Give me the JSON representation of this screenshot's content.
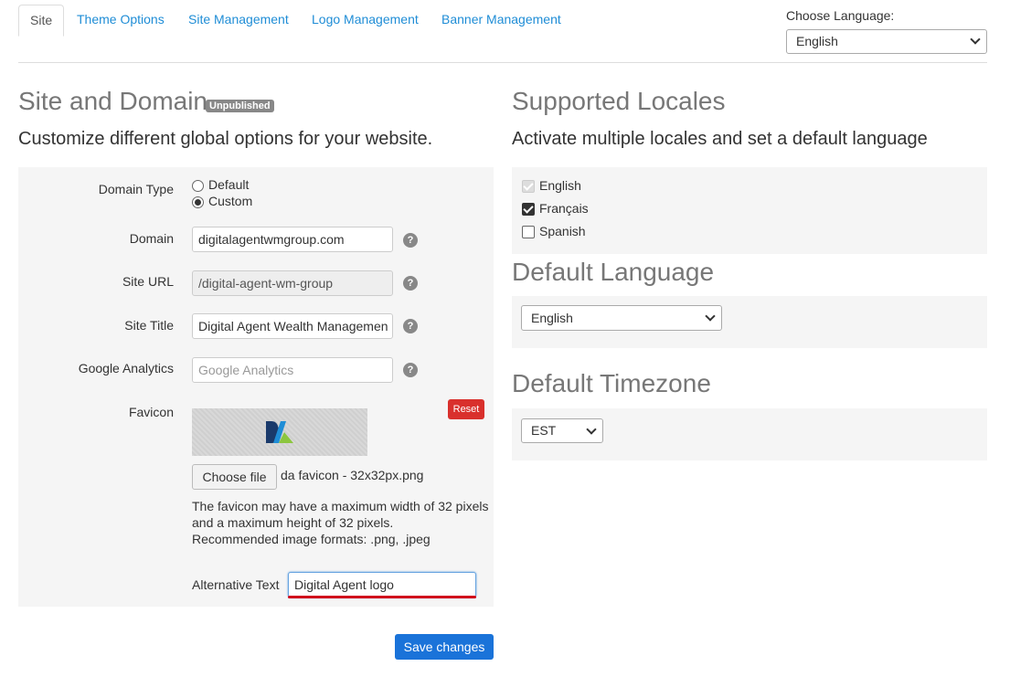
{
  "tabs": [
    "Site",
    "Theme Options",
    "Site Management",
    "Logo Management",
    "Banner Management"
  ],
  "language_chooser": {
    "label": "Choose Language:",
    "value": "English"
  },
  "site_domain": {
    "title": "Site and Domain",
    "badge": "Unpublished",
    "subtitle": "Customize different global options for your website.",
    "domain_type": {
      "label": "Domain Type",
      "options": [
        "Default",
        "Custom"
      ],
      "selected": "Custom"
    },
    "domain": {
      "label": "Domain",
      "value": "digitalagentwmgroup.com"
    },
    "site_url": {
      "label": "Site URL",
      "value": "/digital-agent-wm-group"
    },
    "site_title": {
      "label": "Site Title",
      "value": "Digital Agent Wealth Managemen"
    },
    "google_analytics": {
      "label": "Google Analytics",
      "placeholder": "Google Analytics"
    },
    "favicon": {
      "label": "Favicon",
      "reset_label": "Reset",
      "choose_file_label": "Choose file",
      "file_name": "da favicon - 32x32px.png",
      "help_lines": [
        "The favicon may have a maximum width of 32 pixels",
        "and a maximum height of 32 pixels.",
        "Recommended image formats: .png, .jpeg"
      ],
      "alt_text_label": "Alternative Text",
      "alt_text_value": "Digital Agent logo"
    },
    "save_label": "Save changes"
  },
  "locales": {
    "title": "Supported Locales",
    "subtitle": "Activate multiple locales and set a default language",
    "items": [
      {
        "label": "English",
        "checked": true,
        "disabled": true
      },
      {
        "label": "Français",
        "checked": true,
        "disabled": false
      },
      {
        "label": "Spanish",
        "checked": false,
        "disabled": false
      }
    ]
  },
  "default_language": {
    "title": "Default Language",
    "value": "English"
  },
  "default_timezone": {
    "title": "Default Timezone",
    "value": "EST"
  },
  "colors": {
    "link": "#1f8dd6",
    "primary_button": "#1a73d9",
    "reset_button": "#d9302c",
    "badge": "#888888"
  }
}
